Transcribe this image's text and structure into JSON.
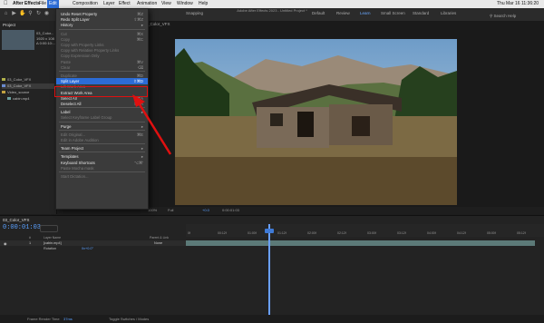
{
  "menubar": {
    "app": "After Effects",
    "items": [
      "File",
      "Edit",
      "Composition",
      "Layer",
      "Effect",
      "Animation",
      "View",
      "Window",
      "Help"
    ],
    "clock": "Thu Mar 16  11:36:20"
  },
  "toolbar": {
    "title": "Adobe After Effects 2023 - Untitled Project *",
    "workspaces": [
      "Default",
      "Review",
      "Learn",
      "Small Screen",
      "Standard",
      "Libraries"
    ],
    "active_workspace": "Learn",
    "snapping": "Snapping",
    "search": "Search Help"
  },
  "project": {
    "tab": "Project",
    "item_name": "03_Color...",
    "item_meta": [
      "1920 x 108",
      "Δ 0:00:10:..."
    ],
    "rows": [
      {
        "label": "03_Color_VFX",
        "color": "#b0b04a"
      },
      {
        "label": "03_Color_VFX",
        "color": "#6a8ad0"
      },
      {
        "label": "Video_source",
        "color": "#c0a040"
      },
      {
        "label": "cabin.mp4",
        "color": "#6aa0a0"
      }
    ]
  },
  "viewer": {
    "tab": "03_Color_VFX",
    "controls": [
      "100%",
      "Full",
      "0:00:01:03",
      "+0.0"
    ]
  },
  "edit_menu": {
    "items": [
      {
        "label": "Undo Reset Property",
        "shortcut": "⌘Z",
        "state": "enabled"
      },
      {
        "label": "Redo Split Layer",
        "shortcut": "⇧⌘Z",
        "state": "enabled"
      },
      {
        "label": "History",
        "shortcut": "▸",
        "state": "enabled"
      },
      {
        "sep": true
      },
      {
        "label": "Cut",
        "shortcut": "⌘X",
        "state": "disabled"
      },
      {
        "label": "Copy",
        "shortcut": "⌘C",
        "state": "disabled"
      },
      {
        "label": "Copy with Property Links",
        "shortcut": "",
        "state": "disabled"
      },
      {
        "label": "Copy with Relative Property Links",
        "shortcut": "",
        "state": "disabled"
      },
      {
        "label": "Copy Expression Only",
        "shortcut": "",
        "state": "disabled"
      },
      {
        "label": "Paste",
        "shortcut": "⌘V",
        "state": "disabled"
      },
      {
        "label": "Clear",
        "shortcut": "⌫",
        "state": "disabled"
      },
      {
        "sep": true
      },
      {
        "label": "Duplicate",
        "shortcut": "⌘D",
        "state": "disabled"
      },
      {
        "label": "Split Layer",
        "shortcut": "⇧⌘D",
        "state": "selected"
      },
      {
        "label": "Lift Work Area",
        "shortcut": "",
        "state": "disabled"
      },
      {
        "label": "Extract Work Area",
        "shortcut": "",
        "state": "enabled"
      },
      {
        "label": "Select All",
        "shortcut": "⌘A",
        "state": "enabled"
      },
      {
        "label": "Deselect All",
        "shortcut": "⇧⌘A",
        "state": "enabled"
      },
      {
        "sep": true
      },
      {
        "label": "Label",
        "shortcut": "▸",
        "state": "enabled"
      },
      {
        "label": "Select Keyframe Label Group",
        "shortcut": "",
        "state": "disabled"
      },
      {
        "sep": true
      },
      {
        "label": "Purge",
        "shortcut": "▸",
        "state": "enabled"
      },
      {
        "sep": true
      },
      {
        "label": "Edit Original...",
        "shortcut": "⌘E",
        "state": "disabled"
      },
      {
        "label": "Edit in Adobe Audition",
        "shortcut": "",
        "state": "disabled"
      },
      {
        "sep": true
      },
      {
        "label": "Team Project",
        "shortcut": "▸",
        "state": "enabled"
      },
      {
        "sep": true
      },
      {
        "label": "Templates",
        "shortcut": "▸",
        "state": "enabled"
      },
      {
        "label": "Keyboard Shortcuts",
        "shortcut": "⌥⌘'",
        "state": "enabled"
      },
      {
        "label": "Paste Mocha mask",
        "shortcut": "",
        "state": "disabled"
      },
      {
        "sep": true
      },
      {
        "label": "Start Dictation...",
        "shortcut": "",
        "state": "disabled"
      }
    ]
  },
  "timeline": {
    "tab": "03_Color_VFX",
    "timecode": "0:00:01:03",
    "columns": [
      "#",
      "Layer Name",
      "Parent & Link"
    ],
    "layer": {
      "index": "1",
      "name": "[cabin.mp4]",
      "parent": "None"
    },
    "rotation": {
      "label": "Rotation",
      "value": "0x+0.0°"
    },
    "ticks": [
      "0f",
      "00:12f",
      "01:00f",
      "01:12f",
      "02:00f",
      "02:12f",
      "03:00f",
      "03:12f",
      "04:00f",
      "04:12f",
      "05:00f",
      "05:12f"
    ],
    "layer_color": "#5c7a78"
  },
  "status": {
    "render": "Frame Render Time",
    "render_value": "37ms",
    "toggle": "Toggle Switches / Modes"
  },
  "colors": {
    "accent": "#2c6cd6",
    "annotation": "#e01010"
  }
}
